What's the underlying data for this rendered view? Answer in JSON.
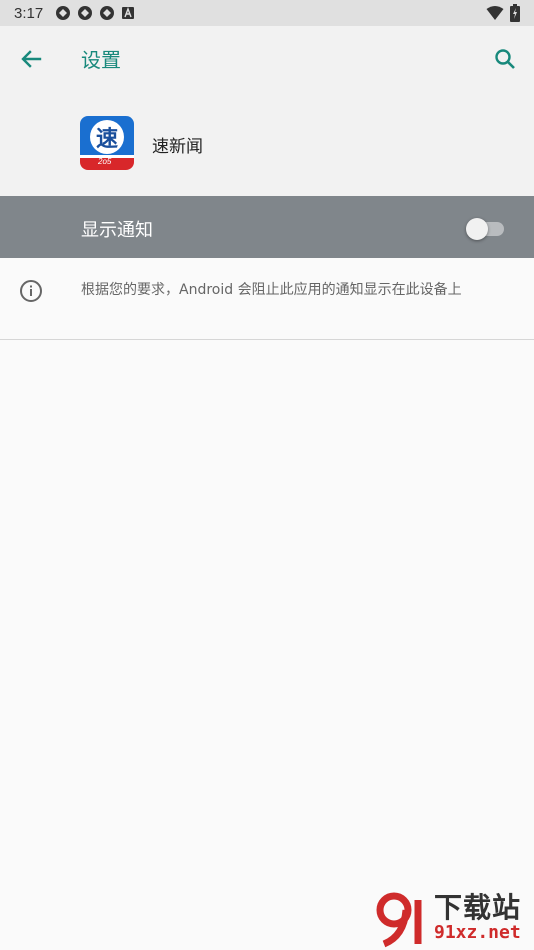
{
  "status_bar": {
    "time": "3:17",
    "icons": [
      "sync-icon",
      "sync-icon",
      "sync-icon",
      "a-badge-icon"
    ],
    "right_icons": [
      "wifi-icon",
      "battery-icon"
    ]
  },
  "toolbar": {
    "title": "设置",
    "back_icon": "arrow-back-icon",
    "search_icon": "search-icon",
    "accent_color": "#18897c"
  },
  "app": {
    "name": "速新闻",
    "icon_glyph": "速",
    "icon_sub": "2o5"
  },
  "notification_setting": {
    "label": "显示通知",
    "enabled": false
  },
  "info": {
    "icon": "info-icon",
    "text": "根据您的要求，Android 会阻止此应用的通知显示在此设备上"
  },
  "watermark": {
    "title": "下载站",
    "url": "91xz.net"
  }
}
